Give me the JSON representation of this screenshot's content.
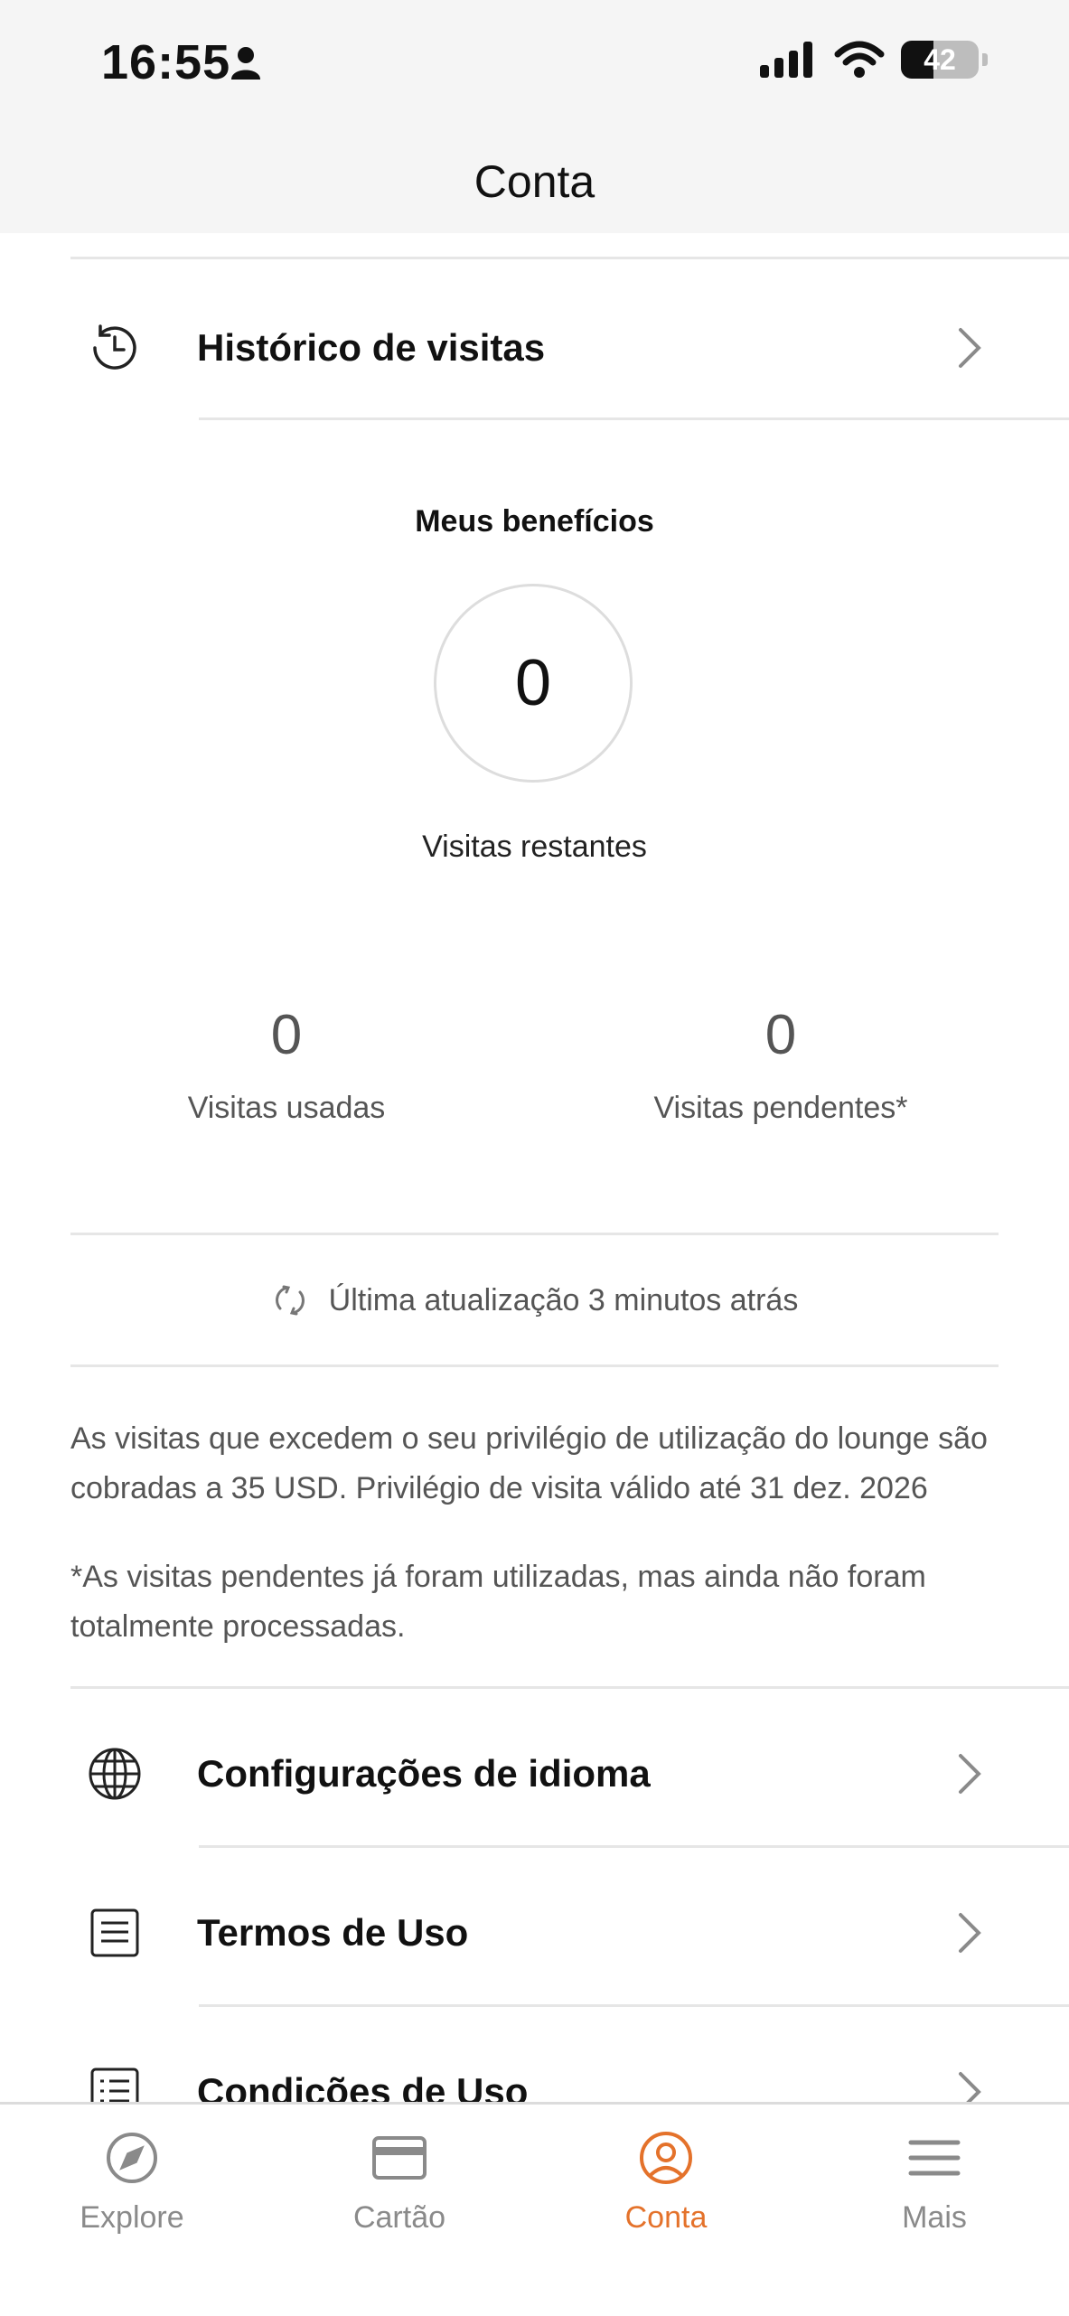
{
  "status_bar": {
    "time": "16:55",
    "battery": "42"
  },
  "header": {
    "title": "Conta"
  },
  "menu_top": {
    "history_label": "Histórico de visitas"
  },
  "benefits": {
    "title": "Meus benefícios",
    "remaining_value": "0",
    "remaining_label": "Visitas restantes",
    "used_value": "0",
    "used_label": "Visitas usadas",
    "pending_value": "0",
    "pending_label": "Visitas pendentes*",
    "last_update": "Última atualização 3 minutos atrás",
    "note_charges": "As visitas que excedem o seu privilégio de utilização do lounge são cobradas a 35 USD. Privilégio de visita válido até 31 dez. 2026",
    "note_pending": "*As visitas pendentes já foram utilizadas, mas ainda não foram totalmente processadas."
  },
  "menu_bottom": {
    "language_label": "Configurações de idioma",
    "terms_label": "Termos de Uso",
    "conditions_label": "Condições de Uso"
  },
  "tabbar": {
    "explore": "Explore",
    "card": "Cartão",
    "account": "Conta",
    "more": "Mais"
  },
  "colors": {
    "accent": "#e4722b",
    "inactive": "#8a8a8a",
    "bar_bg": "#f5f5f5"
  }
}
